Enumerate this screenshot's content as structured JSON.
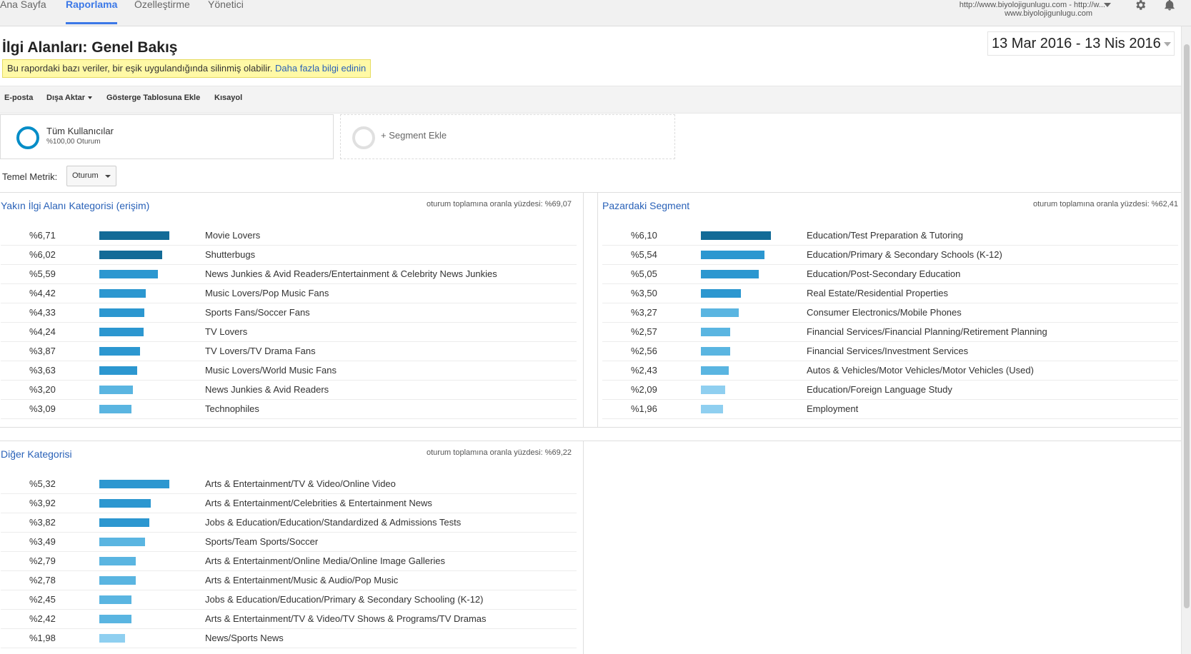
{
  "nav": {
    "tabs": [
      "Ana Sayfa",
      "Raporlama",
      "Özelleştirme",
      "Yönetici"
    ],
    "active_tab": "Raporlama",
    "account_line1": "http://www.biyolojigunlugu.com - http://w...",
    "account_line2": "www.biyolojigunlugu.com",
    "icons": [
      "gear-icon",
      "bell-icon"
    ]
  },
  "page": {
    "title": "İlgi Alanları: Genel Bakış",
    "date_range": "13 Mar 2016 - 13 Nis 2016"
  },
  "notice": {
    "text": "Bu rapordaki bazı veriler, bir eşik uygulandığında silinmiş olabilir.",
    "link": "Daha fazla bilgi edinin"
  },
  "toolbar": {
    "email": "E-posta",
    "export": "Dışa Aktar",
    "add_dashboard": "Gösterge Tablosuna Ekle",
    "shortcut": "Kısayol"
  },
  "segments": {
    "segment1_name": "Tüm Kullanıcılar",
    "segment1_sub": "%100,00 Oturum",
    "add_segment": "+ Segment Ekle"
  },
  "metric": {
    "label": "Temel Metrik:",
    "value": "Oturum"
  },
  "colors": {
    "bar_dark": "#136b97",
    "bar_mid": "#2c97d0",
    "bar_light": "#5ab5e1",
    "bar_pale": "#8fcff0",
    "link": "#2a62b8"
  },
  "affinity": {
    "title": "Yakın İlgi Alanı Kategorisi (erişim)",
    "total": "oturum toplamına oranla yüzdesi: %69,07",
    "rows": [
      {
        "pct": "%6,71",
        "value": 6.71,
        "label": "Movie Lovers"
      },
      {
        "pct": "%6,02",
        "value": 6.02,
        "label": "Shutterbugs"
      },
      {
        "pct": "%5,59",
        "value": 5.59,
        "label": "News Junkies & Avid Readers/Entertainment & Celebrity News Junkies"
      },
      {
        "pct": "%4,42",
        "value": 4.42,
        "label": "Music Lovers/Pop Music Fans"
      },
      {
        "pct": "%4,33",
        "value": 4.33,
        "label": "Sports Fans/Soccer Fans"
      },
      {
        "pct": "%4,24",
        "value": 4.24,
        "label": "TV Lovers"
      },
      {
        "pct": "%3,87",
        "value": 3.87,
        "label": "TV Lovers/TV Drama Fans"
      },
      {
        "pct": "%3,63",
        "value": 3.63,
        "label": "Music Lovers/World Music Fans"
      },
      {
        "pct": "%3,20",
        "value": 3.2,
        "label": "News Junkies & Avid Readers"
      },
      {
        "pct": "%3,09",
        "value": 3.09,
        "label": "Technophiles"
      }
    ]
  },
  "inmarket": {
    "title": "Pazardaki Segment",
    "total": "oturum toplamına oranla yüzdesi: %62,41",
    "rows": [
      {
        "pct": "%6,10",
        "value": 6.1,
        "label": "Education/Test Preparation & Tutoring"
      },
      {
        "pct": "%5,54",
        "value": 5.54,
        "label": "Education/Primary & Secondary Schools (K-12)"
      },
      {
        "pct": "%5,05",
        "value": 5.05,
        "label": "Education/Post-Secondary Education"
      },
      {
        "pct": "%3,50",
        "value": 3.5,
        "label": "Real Estate/Residential Properties"
      },
      {
        "pct": "%3,27",
        "value": 3.27,
        "label": "Consumer Electronics/Mobile Phones"
      },
      {
        "pct": "%2,57",
        "value": 2.57,
        "label": "Financial Services/Financial Planning/Retirement Planning"
      },
      {
        "pct": "%2,56",
        "value": 2.56,
        "label": "Financial Services/Investment Services"
      },
      {
        "pct": "%2,43",
        "value": 2.43,
        "label": "Autos & Vehicles/Motor Vehicles/Motor Vehicles (Used)"
      },
      {
        "pct": "%2,09",
        "value": 2.09,
        "label": "Education/Foreign Language Study"
      },
      {
        "pct": "%1,96",
        "value": 1.96,
        "label": "Employment"
      }
    ]
  },
  "other": {
    "title": "Diğer Kategorisi",
    "total": "oturum toplamına oranla yüzdesi: %69,22",
    "rows": [
      {
        "pct": "%5,32",
        "value": 5.32,
        "label": "Arts & Entertainment/TV & Video/Online Video"
      },
      {
        "pct": "%3,92",
        "value": 3.92,
        "label": "Arts & Entertainment/Celebrities & Entertainment News"
      },
      {
        "pct": "%3,82",
        "value": 3.82,
        "label": "Jobs & Education/Education/Standardized & Admissions Tests"
      },
      {
        "pct": "%3,49",
        "value": 3.49,
        "label": "Sports/Team Sports/Soccer"
      },
      {
        "pct": "%2,79",
        "value": 2.79,
        "label": "Arts & Entertainment/Online Media/Online Image Galleries"
      },
      {
        "pct": "%2,78",
        "value": 2.78,
        "label": "Arts & Entertainment/Music & Audio/Pop Music"
      },
      {
        "pct": "%2,45",
        "value": 2.45,
        "label": "Jobs & Education/Education/Primary & Secondary Schooling (K-12)"
      },
      {
        "pct": "%2,42",
        "value": 2.42,
        "label": "Arts & Entertainment/TV & Video/TV Shows & Programs/TV Dramas"
      },
      {
        "pct": "%1,98",
        "value": 1.98,
        "label": "News/Sports News"
      }
    ]
  }
}
